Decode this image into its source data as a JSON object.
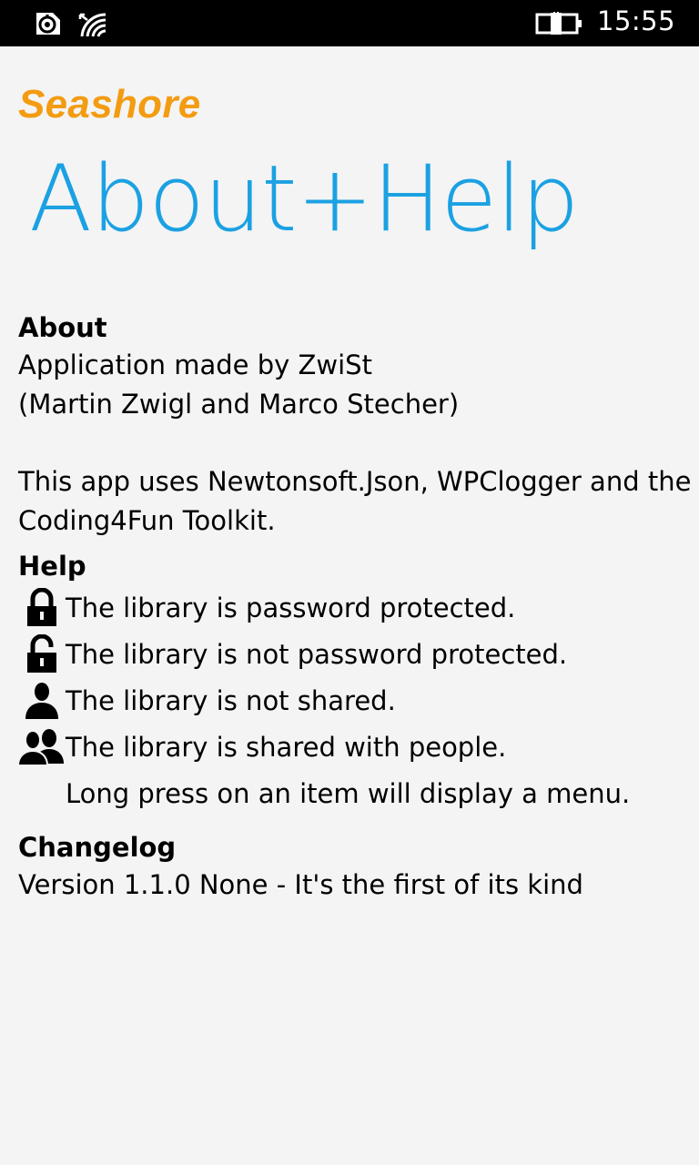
{
  "status_bar": {
    "time": "15:55",
    "icons": [
      "data-sense-icon",
      "wifi-icon",
      "battery-charging-icon"
    ]
  },
  "app": {
    "name": "Seashore",
    "page_title": "About+Help"
  },
  "about": {
    "heading": "About",
    "lines": [
      "Application made by ZwiSt",
      "(Martin Zwigl and Marco Stecher)"
    ],
    "libraries_line1": "This app uses Newtonsoft.Json, WPClogger and the",
    "libraries_line2": "Coding4Fun Toolkit."
  },
  "help": {
    "heading": "Help",
    "items": [
      {
        "icon": "lock-closed-icon",
        "text": "The library is password protected."
      },
      {
        "icon": "lock-open-icon",
        "text": "The library is not password protected."
      },
      {
        "icon": "person-icon",
        "text": "The library is not shared."
      },
      {
        "icon": "people-icon",
        "text": "The library is shared with people."
      },
      {
        "icon": "",
        "text": "Long press on an item will display a menu."
      }
    ]
  },
  "changelog": {
    "heading": "Changelog",
    "entry": "Version 1.1.0 None - It's the first of its kind"
  },
  "colors": {
    "accent": "#1ba1e2",
    "app_title": "#f39c12",
    "background": "#f4f4f4",
    "status_bar": "#000000"
  }
}
